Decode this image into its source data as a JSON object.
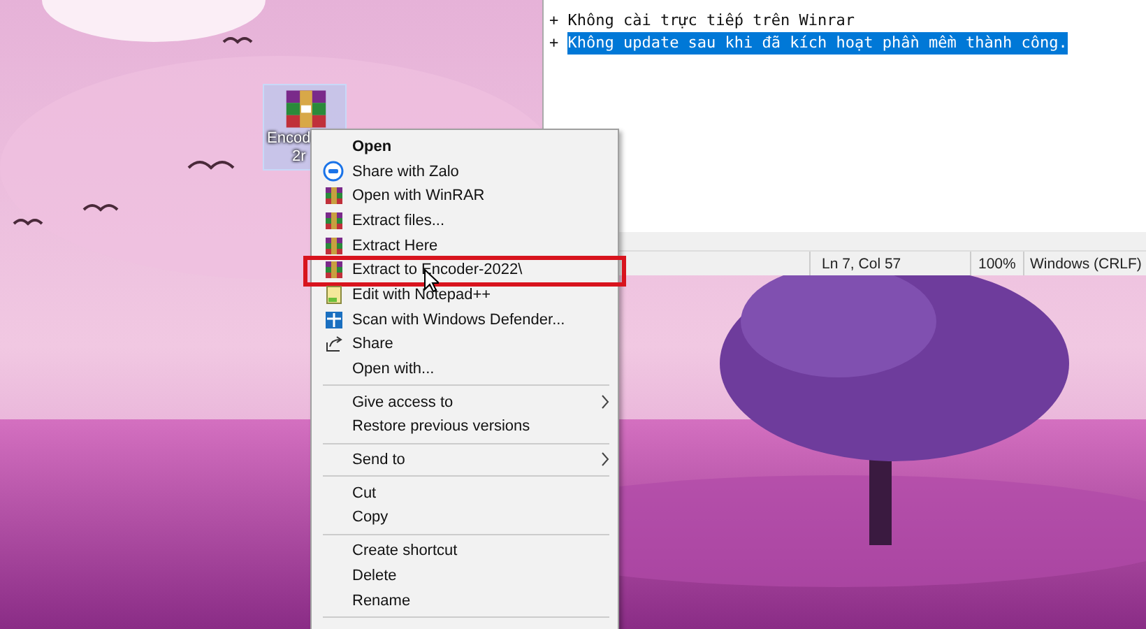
{
  "desktop_icon": {
    "label_lines": [
      "Encod",
      "2r"
    ],
    "selected": true
  },
  "notepad": {
    "lines": [
      {
        "prefix": "+",
        "text": "Không cài trực tiếp trên Winrar",
        "selected": false
      },
      {
        "prefix": "+",
        "text": "Không update sau khi đã kích hoạt phần mềm thành công.",
        "selected": true
      }
    ],
    "status_bar": {
      "position": "Ln 7, Col 57",
      "zoom": "100%",
      "line_ending": "Windows (CRLF)"
    }
  },
  "context_menu": {
    "items": [
      {
        "kind": "plain",
        "label": "Open",
        "default": true,
        "highlighted": false
      },
      {
        "kind": "zalo",
        "label": "Share with Zalo",
        "default": false,
        "highlighted": false
      },
      {
        "kind": "archive",
        "label": "Open with WinRAR",
        "default": false,
        "highlighted": false
      },
      {
        "kind": "archive",
        "label": "Extract files...",
        "default": false,
        "highlighted": false
      },
      {
        "kind": "archive",
        "label": "Extract Here",
        "default": false,
        "highlighted": false
      },
      {
        "kind": "archive",
        "label": "Extract to Encoder-2022\\",
        "default": false,
        "highlighted": true
      },
      {
        "kind": "editor",
        "label": "Edit with Notepad++",
        "default": false,
        "highlighted": false
      },
      {
        "kind": "shield",
        "label": "Scan with Windows Defender...",
        "default": false,
        "highlighted": false
      },
      {
        "kind": "share",
        "label": "Share",
        "default": false,
        "highlighted": false
      },
      {
        "kind": "plain",
        "label": "Open with...",
        "default": false,
        "highlighted": false
      },
      {
        "kind": "separator"
      },
      {
        "kind": "submenu",
        "label": "Give access to",
        "default": false,
        "highlighted": false
      },
      {
        "kind": "plain",
        "label": "Restore previous versions",
        "default": false,
        "highlighted": false
      },
      {
        "kind": "separator"
      },
      {
        "kind": "submenu",
        "label": "Send to",
        "default": false,
        "highlighted": false
      },
      {
        "kind": "separator"
      },
      {
        "kind": "plain",
        "label": "Cut",
        "default": false,
        "highlighted": false
      },
      {
        "kind": "plain",
        "label": "Copy",
        "default": false,
        "highlighted": false
      },
      {
        "kind": "separator"
      },
      {
        "kind": "plain",
        "label": "Create shortcut",
        "default": false,
        "highlighted": false
      },
      {
        "kind": "plain",
        "label": "Delete",
        "default": false,
        "highlighted": false
      },
      {
        "kind": "plain",
        "label": "Rename",
        "default": false,
        "highlighted": false
      },
      {
        "kind": "separator"
      }
    ]
  }
}
